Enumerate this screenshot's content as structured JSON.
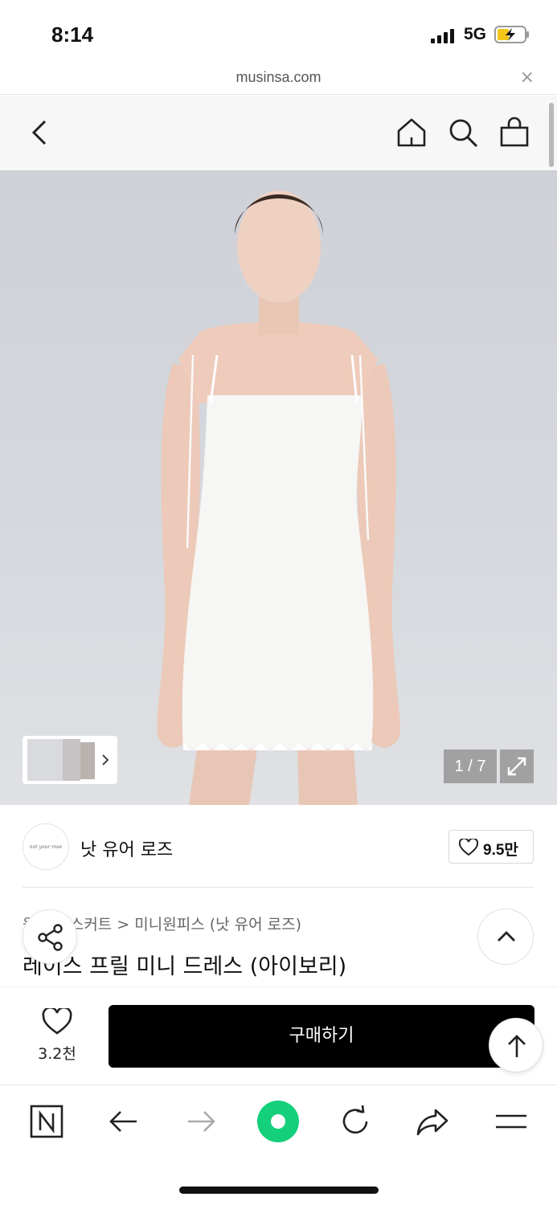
{
  "status_bar": {
    "time": "8:14",
    "network": "5G"
  },
  "browser": {
    "url": "musinsa.com",
    "close_label": "×"
  },
  "gallery": {
    "pager": "1 / 7"
  },
  "brand": {
    "logo_text": "not your rose",
    "name": "낫 유어 로즈",
    "likes": "9.5만"
  },
  "breadcrumb": "원피스/스커트 > 미니원피스 (낫 유어 로즈)",
  "product": {
    "title": "레이스 프릴 미니 드레스 (아이보리)"
  },
  "purchase": {
    "wish_count": "3.2천",
    "buy_label": "구매하기"
  },
  "colors": {
    "accent_green": "#14d07b",
    "buy_button": "#000000"
  }
}
